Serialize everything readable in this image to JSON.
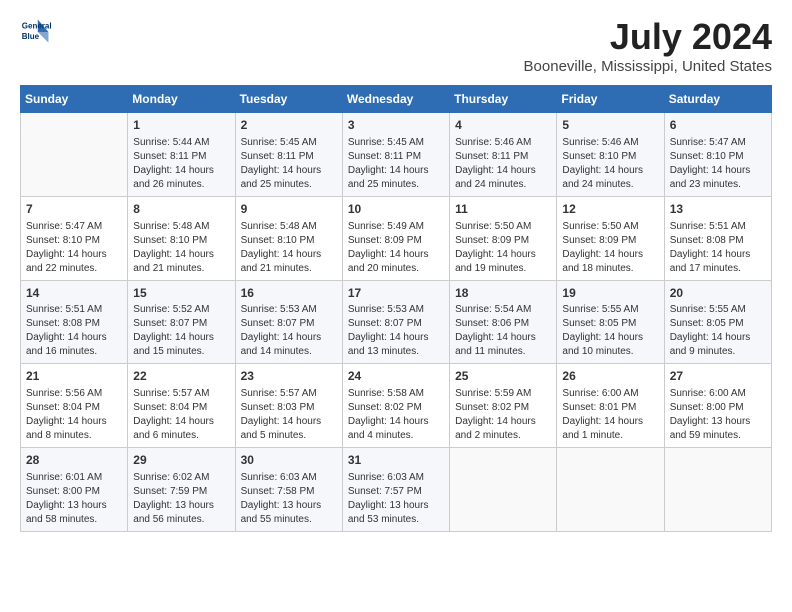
{
  "header": {
    "logo_line1": "General",
    "logo_line2": "Blue",
    "month": "July 2024",
    "location": "Booneville, Mississippi, United States"
  },
  "weekdays": [
    "Sunday",
    "Monday",
    "Tuesday",
    "Wednesday",
    "Thursday",
    "Friday",
    "Saturday"
  ],
  "weeks": [
    [
      {
        "day": "",
        "info": ""
      },
      {
        "day": "1",
        "info": "Sunrise: 5:44 AM\nSunset: 8:11 PM\nDaylight: 14 hours\nand 26 minutes."
      },
      {
        "day": "2",
        "info": "Sunrise: 5:45 AM\nSunset: 8:11 PM\nDaylight: 14 hours\nand 25 minutes."
      },
      {
        "day": "3",
        "info": "Sunrise: 5:45 AM\nSunset: 8:11 PM\nDaylight: 14 hours\nand 25 minutes."
      },
      {
        "day": "4",
        "info": "Sunrise: 5:46 AM\nSunset: 8:11 PM\nDaylight: 14 hours\nand 24 minutes."
      },
      {
        "day": "5",
        "info": "Sunrise: 5:46 AM\nSunset: 8:10 PM\nDaylight: 14 hours\nand 24 minutes."
      },
      {
        "day": "6",
        "info": "Sunrise: 5:47 AM\nSunset: 8:10 PM\nDaylight: 14 hours\nand 23 minutes."
      }
    ],
    [
      {
        "day": "7",
        "info": "Sunrise: 5:47 AM\nSunset: 8:10 PM\nDaylight: 14 hours\nand 22 minutes."
      },
      {
        "day": "8",
        "info": "Sunrise: 5:48 AM\nSunset: 8:10 PM\nDaylight: 14 hours\nand 21 minutes."
      },
      {
        "day": "9",
        "info": "Sunrise: 5:48 AM\nSunset: 8:10 PM\nDaylight: 14 hours\nand 21 minutes."
      },
      {
        "day": "10",
        "info": "Sunrise: 5:49 AM\nSunset: 8:09 PM\nDaylight: 14 hours\nand 20 minutes."
      },
      {
        "day": "11",
        "info": "Sunrise: 5:50 AM\nSunset: 8:09 PM\nDaylight: 14 hours\nand 19 minutes."
      },
      {
        "day": "12",
        "info": "Sunrise: 5:50 AM\nSunset: 8:09 PM\nDaylight: 14 hours\nand 18 minutes."
      },
      {
        "day": "13",
        "info": "Sunrise: 5:51 AM\nSunset: 8:08 PM\nDaylight: 14 hours\nand 17 minutes."
      }
    ],
    [
      {
        "day": "14",
        "info": "Sunrise: 5:51 AM\nSunset: 8:08 PM\nDaylight: 14 hours\nand 16 minutes."
      },
      {
        "day": "15",
        "info": "Sunrise: 5:52 AM\nSunset: 8:07 PM\nDaylight: 14 hours\nand 15 minutes."
      },
      {
        "day": "16",
        "info": "Sunrise: 5:53 AM\nSunset: 8:07 PM\nDaylight: 14 hours\nand 14 minutes."
      },
      {
        "day": "17",
        "info": "Sunrise: 5:53 AM\nSunset: 8:07 PM\nDaylight: 14 hours\nand 13 minutes."
      },
      {
        "day": "18",
        "info": "Sunrise: 5:54 AM\nSunset: 8:06 PM\nDaylight: 14 hours\nand 11 minutes."
      },
      {
        "day": "19",
        "info": "Sunrise: 5:55 AM\nSunset: 8:05 PM\nDaylight: 14 hours\nand 10 minutes."
      },
      {
        "day": "20",
        "info": "Sunrise: 5:55 AM\nSunset: 8:05 PM\nDaylight: 14 hours\nand 9 minutes."
      }
    ],
    [
      {
        "day": "21",
        "info": "Sunrise: 5:56 AM\nSunset: 8:04 PM\nDaylight: 14 hours\nand 8 minutes."
      },
      {
        "day": "22",
        "info": "Sunrise: 5:57 AM\nSunset: 8:04 PM\nDaylight: 14 hours\nand 6 minutes."
      },
      {
        "day": "23",
        "info": "Sunrise: 5:57 AM\nSunset: 8:03 PM\nDaylight: 14 hours\nand 5 minutes."
      },
      {
        "day": "24",
        "info": "Sunrise: 5:58 AM\nSunset: 8:02 PM\nDaylight: 14 hours\nand 4 minutes."
      },
      {
        "day": "25",
        "info": "Sunrise: 5:59 AM\nSunset: 8:02 PM\nDaylight: 14 hours\nand 2 minutes."
      },
      {
        "day": "26",
        "info": "Sunrise: 6:00 AM\nSunset: 8:01 PM\nDaylight: 14 hours\nand 1 minute."
      },
      {
        "day": "27",
        "info": "Sunrise: 6:00 AM\nSunset: 8:00 PM\nDaylight: 13 hours\nand 59 minutes."
      }
    ],
    [
      {
        "day": "28",
        "info": "Sunrise: 6:01 AM\nSunset: 8:00 PM\nDaylight: 13 hours\nand 58 minutes."
      },
      {
        "day": "29",
        "info": "Sunrise: 6:02 AM\nSunset: 7:59 PM\nDaylight: 13 hours\nand 56 minutes."
      },
      {
        "day": "30",
        "info": "Sunrise: 6:03 AM\nSunset: 7:58 PM\nDaylight: 13 hours\nand 55 minutes."
      },
      {
        "day": "31",
        "info": "Sunrise: 6:03 AM\nSunset: 7:57 PM\nDaylight: 13 hours\nand 53 minutes."
      },
      {
        "day": "",
        "info": ""
      },
      {
        "day": "",
        "info": ""
      },
      {
        "day": "",
        "info": ""
      }
    ]
  ]
}
